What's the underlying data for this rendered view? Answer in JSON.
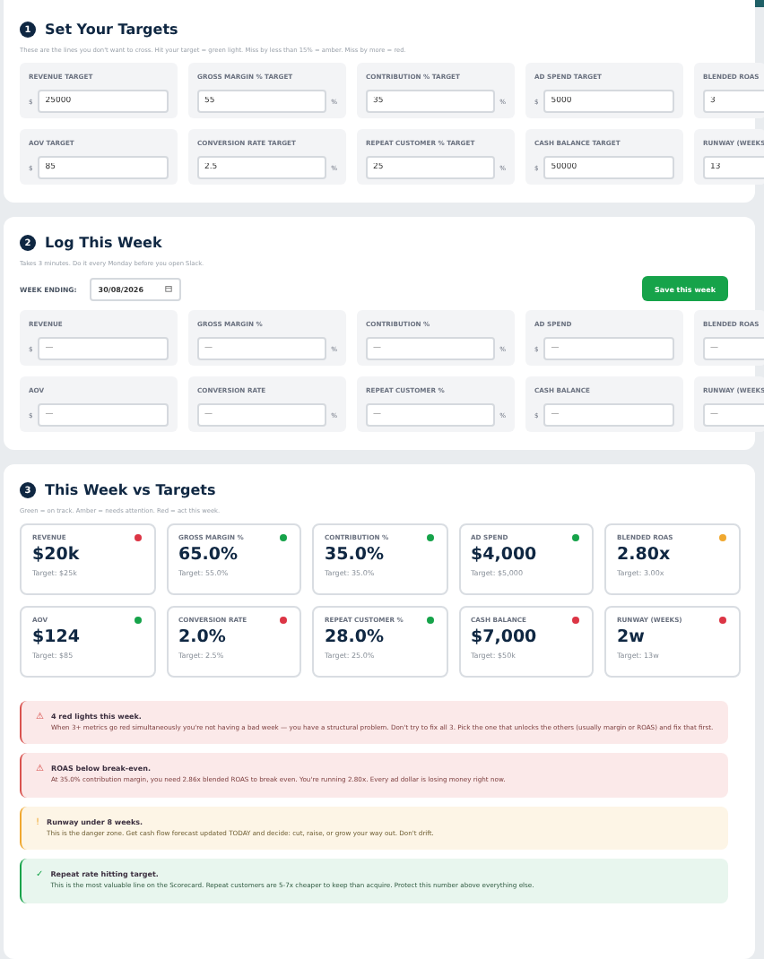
{
  "targets": {
    "number": "1",
    "title": "Set Your Targets",
    "subtitle": "These are the lines you don't want to cross. Hit your target = green light. Miss by less than 15% = amber. Miss by more = red.",
    "fields": [
      {
        "label": "REVENUE TARGET",
        "prefix": "$",
        "value": "25000"
      },
      {
        "label": "GROSS MARGIN % TARGET",
        "suffix": "%",
        "value": "55"
      },
      {
        "label": "CONTRIBUTION % TARGET",
        "suffix": "%",
        "value": "35"
      },
      {
        "label": "AD SPEND TARGET",
        "prefix": "$",
        "value": "5000"
      },
      {
        "label": "BLENDED ROAS",
        "value": "3"
      },
      {
        "label": "AOV TARGET",
        "prefix": "$",
        "value": "85"
      },
      {
        "label": "CONVERSION RATE TARGET",
        "suffix": "%",
        "value": "2.5"
      },
      {
        "label": "REPEAT CUSTOMER % TARGET",
        "suffix": "%",
        "value": "25"
      },
      {
        "label": "CASH BALANCE TARGET",
        "prefix": "$",
        "value": "50000"
      },
      {
        "label": "RUNWAY (WEEKS",
        "value": "13"
      }
    ]
  },
  "log": {
    "number": "2",
    "title": "Log This Week",
    "subtitle": "Takes 3 minutes. Do it every Monday before you open Slack.",
    "week_label": "WEEK ENDING:",
    "week_value": "30/08/2026",
    "save_button": "Save this week",
    "fields": [
      {
        "label": "REVENUE",
        "prefix": "$",
        "placeholder": "—"
      },
      {
        "label": "GROSS MARGIN %",
        "suffix": "%",
        "placeholder": "—"
      },
      {
        "label": "CONTRIBUTION %",
        "suffix": "%",
        "placeholder": "—"
      },
      {
        "label": "AD SPEND",
        "prefix": "$",
        "placeholder": "—"
      },
      {
        "label": "BLENDED ROAS",
        "placeholder": "—"
      },
      {
        "label": "AOV",
        "prefix": "$",
        "placeholder": "—"
      },
      {
        "label": "CONVERSION RATE",
        "suffix": "%",
        "placeholder": "—"
      },
      {
        "label": "REPEAT CUSTOMER %",
        "suffix": "%",
        "placeholder": "—"
      },
      {
        "label": "CASH BALANCE",
        "prefix": "$",
        "placeholder": "—"
      },
      {
        "label": "RUNWAY (WEEKS",
        "placeholder": "—"
      }
    ]
  },
  "results": {
    "number": "3",
    "title": "This Week vs Targets",
    "subtitle": "Green = on track. Amber = needs attention. Red = act this week.",
    "metrics": [
      {
        "label": "REVENUE",
        "value": "$20k",
        "target": "Target: $25k",
        "color": "#dc3545"
      },
      {
        "label": "GROSS MARGIN %",
        "value": "65.0%",
        "target": "Target: 55.0%",
        "color": "#16a34a"
      },
      {
        "label": "CONTRIBUTION %",
        "value": "35.0%",
        "target": "Target: 35.0%",
        "color": "#16a34a"
      },
      {
        "label": "AD SPEND",
        "value": "$4,000",
        "target": "Target: $5,000",
        "color": "#16a34a"
      },
      {
        "label": "BLENDED ROAS",
        "value": "2.80x",
        "target": "Target: 3.00x",
        "color": "#f0a830"
      },
      {
        "label": "AOV",
        "value": "$124",
        "target": "Target: $85",
        "color": "#16a34a"
      },
      {
        "label": "CONVERSION RATE",
        "value": "2.0%",
        "target": "Target: 2.5%",
        "color": "#dc3545"
      },
      {
        "label": "REPEAT CUSTOMER %",
        "value": "28.0%",
        "target": "Target: 25.0%",
        "color": "#16a34a"
      },
      {
        "label": "CASH BALANCE",
        "value": "$7,000",
        "target": "Target: $50k",
        "color": "#dc3545"
      },
      {
        "label": "RUNWAY (WEEKS)",
        "value": "2w",
        "target": "Target: 13w",
        "color": "#dc3545"
      }
    ],
    "alerts": [
      {
        "kind": "danger",
        "icon": "⚠",
        "title": "4 red lights this week.",
        "text": "When 3+ metrics go red simultaneously you're not having a bad week — you have a structural problem. Don't try to fix all 3. Pick the one that unlocks the others (usually margin or ROAS) and fix that first."
      },
      {
        "kind": "danger",
        "icon": "⚠",
        "title": "ROAS below break-even.",
        "text": "At 35.0% contribution margin, you need 2.86x blended ROAS to break even. You're running 2.80x. Every ad dollar is losing money right now."
      },
      {
        "kind": "warning",
        "icon": "!",
        "title": "Runway under 8 weeks.",
        "text": "This is the danger zone. Get cash flow forecast updated TODAY and decide: cut, raise, or grow your way out. Don't drift."
      },
      {
        "kind": "success",
        "icon": "✓",
        "title": "Repeat rate hitting target.",
        "text": "This is the most valuable line on the Scorecard. Repeat customers are 5-7x cheaper to keep than acquire. Protect this number above everything else."
      }
    ]
  }
}
